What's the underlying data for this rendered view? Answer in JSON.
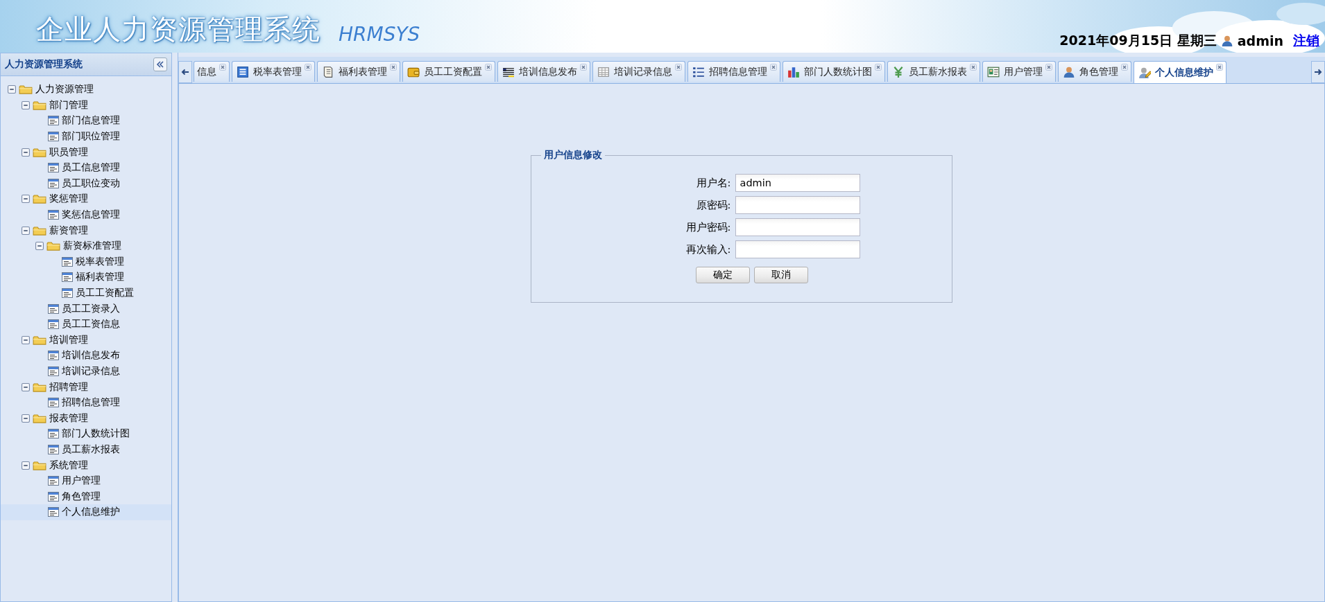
{
  "header": {
    "title": "企业人力资源管理系统",
    "subtitle": "HRMSYS",
    "date": "2021年09月15日 星期三",
    "user": "admin",
    "logout": "注销"
  },
  "sidebar": {
    "title": "人力资源管理系统",
    "tree": [
      {
        "label": "人力资源管理",
        "expanded": true,
        "children": [
          {
            "label": "部门管理",
            "expanded": true,
            "children": [
              {
                "label": "部门信息管理",
                "selected": false
              },
              {
                "label": "部门职位管理",
                "selected": false
              }
            ]
          },
          {
            "label": "职员管理",
            "expanded": true,
            "children": [
              {
                "label": "员工信息管理",
                "selected": false
              },
              {
                "label": "员工职位变动",
                "selected": false
              }
            ]
          },
          {
            "label": "奖惩管理",
            "expanded": true,
            "children": [
              {
                "label": "奖惩信息管理",
                "selected": false
              }
            ]
          },
          {
            "label": "薪资管理",
            "expanded": true,
            "children": [
              {
                "label": "薪资标准管理",
                "expanded": true,
                "children": [
                  {
                    "label": "税率表管理",
                    "selected": false
                  },
                  {
                    "label": "福利表管理",
                    "selected": false
                  },
                  {
                    "label": "员工工资配置",
                    "selected": false
                  }
                ]
              },
              {
                "label": "员工工资录入",
                "selected": false
              },
              {
                "label": "员工工资信息",
                "selected": false
              }
            ]
          },
          {
            "label": "培训管理",
            "expanded": true,
            "children": [
              {
                "label": "培训信息发布",
                "selected": false
              },
              {
                "label": "培训记录信息",
                "selected": false
              }
            ]
          },
          {
            "label": "招聘管理",
            "expanded": true,
            "children": [
              {
                "label": "招聘信息管理",
                "selected": false
              }
            ]
          },
          {
            "label": "报表管理",
            "expanded": true,
            "children": [
              {
                "label": "部门人数统计图",
                "selected": false
              },
              {
                "label": "员工薪水报表",
                "selected": false
              }
            ]
          },
          {
            "label": "系统管理",
            "expanded": true,
            "children": [
              {
                "label": "用户管理",
                "selected": false
              },
              {
                "label": "角色管理",
                "selected": false
              },
              {
                "label": "个人信息维护",
                "selected": true
              }
            ]
          }
        ]
      }
    ]
  },
  "tabs": [
    {
      "label": "信息",
      "selected": false
    },
    {
      "label": "税率表管理",
      "selected": false
    },
    {
      "label": "福利表管理",
      "selected": false
    },
    {
      "label": "员工工资配置",
      "selected": false
    },
    {
      "label": "培训信息发布",
      "selected": false
    },
    {
      "label": "培训记录信息",
      "selected": false
    },
    {
      "label": "招聘信息管理",
      "selected": false
    },
    {
      "label": "部门人数统计图",
      "selected": false
    },
    {
      "label": "员工薪水报表",
      "selected": false
    },
    {
      "label": "用户管理",
      "selected": false
    },
    {
      "label": "角色管理",
      "selected": false
    },
    {
      "label": "个人信息维护",
      "selected": true
    }
  ],
  "form": {
    "legend": "用户信息修改",
    "fields": [
      {
        "label": "用户名:",
        "value": "admin"
      },
      {
        "label": "原密码:"
      },
      {
        "label": "用户密码:"
      },
      {
        "label": "再次输入:"
      }
    ],
    "buttons": [
      "确定",
      "取消"
    ]
  }
}
